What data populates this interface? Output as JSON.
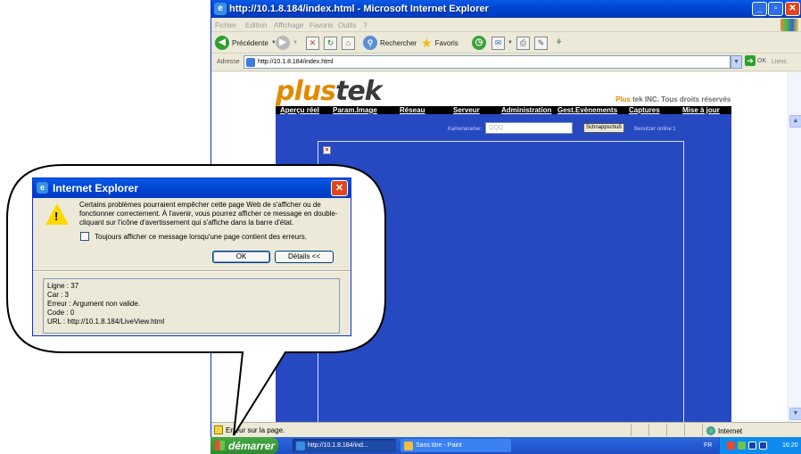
{
  "window": {
    "title": "http://10.1.8.184/index.html - Microsoft Internet Explorer",
    "menu": [
      "Fichier",
      "Edition",
      "Affichage",
      "Favoris",
      "Outils",
      "?"
    ],
    "toolbar": {
      "back_label": "Précédente",
      "search_label": "Rechercher",
      "favorites_label": "Favoris"
    },
    "address": {
      "label": "Adresse",
      "value": "http://10.1.8.184/index.html",
      "go_label": "OK",
      "links_label": "Liens"
    },
    "status": {
      "message": "Erreur sur la page.",
      "zone": "Internet"
    }
  },
  "page": {
    "logo_part1": "plus",
    "logo_part2": "tek",
    "copyright_brand": "Plus",
    "copyright_rest": "tek INC. Tous droits réservés",
    "nav": [
      "Aperçu réel",
      "Param.Image",
      "Réseau",
      "Serveur",
      "Administration",
      "Gest.Evènements",
      "Captures",
      "Mise à jour"
    ],
    "camera_name_label": "Kameraname:",
    "camera_name_value": "QQQ",
    "snapshot_button": "Schnappschuß",
    "users_online": "Benutzer online:1"
  },
  "dialog": {
    "title": "Internet Explorer",
    "message": "Certains problèmes pourraient empêcher cette page Web de s'afficher ou de fonctionner correctement. À l'avenir, vous pourrez afficher ce message en double-cliquant sur l'icône d'avertissement qui s'affiche dans la barre d'état.",
    "checkbox_label": "Toujours afficher ce message lorsqu'une page contient des erreurs.",
    "checkbox_checked": false,
    "ok_button": "OK",
    "details_button": "Détails <<",
    "details": [
      "Ligne : 37",
      "Car : 3",
      "Erreur : Argument non valide.",
      "Code : 0",
      "URL : http://10.1.8.184/LiveView.html"
    ]
  },
  "taskbar": {
    "start_label": "démarrer",
    "tasks": [
      "http://10.1.8.184/ind...",
      "Sans titre - Paint"
    ],
    "language": "FR",
    "clock": "16:20"
  },
  "colors": {
    "xp_blue": "#0047d4",
    "page_blue": "#2649c1",
    "plustek_orange": "#e28a00",
    "start_green": "#2f8b2f"
  }
}
